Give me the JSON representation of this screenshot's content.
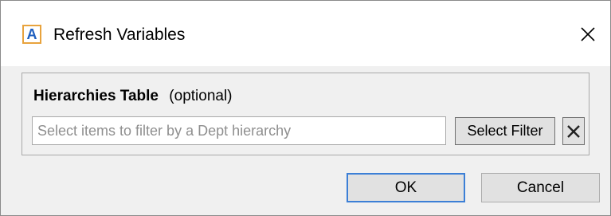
{
  "dialog": {
    "title": "Refresh Variables",
    "app_icon_letter": "A",
    "app_icon": "app-logo-icon",
    "close_icon": "close-icon"
  },
  "hierarchies": {
    "label": "Hierarchies Table",
    "optional_label": "(optional)",
    "input_value": "",
    "input_placeholder": "Select items to filter by a Dept hierarchy",
    "select_filter_label": "Select Filter",
    "clear_icon": "clear-x-icon"
  },
  "buttons": {
    "ok_label": "OK",
    "cancel_label": "Cancel"
  },
  "colors": {
    "dialog_background": "#f0f0f0",
    "title_background": "#ffffff",
    "icon_border": "#e8a33d",
    "icon_letter": "#1f5fbf",
    "default_button_border": "#3c7fd6",
    "button_background": "#e1e1e1"
  }
}
